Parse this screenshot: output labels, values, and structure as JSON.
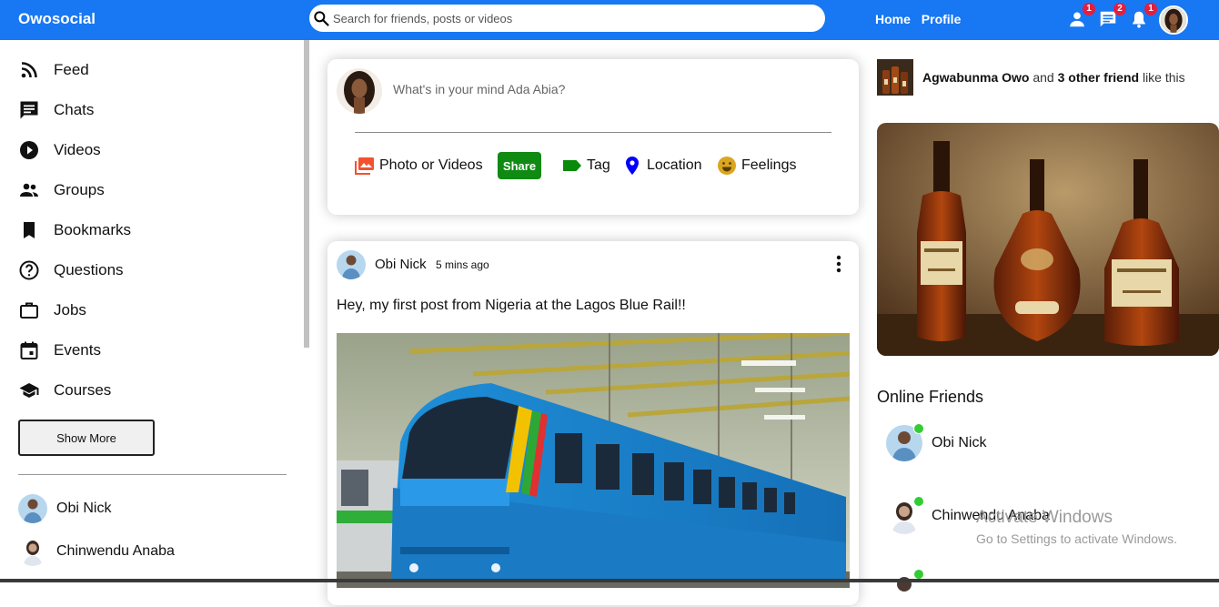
{
  "brand": {
    "name": "Owosocial",
    "color": "#1877f2"
  },
  "search": {
    "placeholder": "Search for friends, posts or videos"
  },
  "topbar": {
    "links": [
      "Home",
      "Profile"
    ],
    "badges": {
      "friends": "1",
      "chat": "2",
      "notifications": "1"
    }
  },
  "sidebar": {
    "items": [
      {
        "label": "Feed",
        "icon": "rss-feed-icon"
      },
      {
        "label": "Chats",
        "icon": "chat-icon"
      },
      {
        "label": "Videos",
        "icon": "play-circle-icon"
      },
      {
        "label": "Groups",
        "icon": "group-icon"
      },
      {
        "label": "Bookmarks",
        "icon": "bookmark-icon"
      },
      {
        "label": "Questions",
        "icon": "help-circle-icon"
      },
      {
        "label": "Jobs",
        "icon": "briefcase-icon"
      },
      {
        "label": "Events",
        "icon": "calendar-event-icon"
      },
      {
        "label": "Courses",
        "icon": "school-icon"
      }
    ],
    "show_more": "Show More",
    "friends": [
      "Obi Nick",
      "Chinwendu Anaba"
    ]
  },
  "share": {
    "placeholder": "What's in your mind Ada Abia?",
    "options": {
      "photo": "Photo or Videos",
      "tag": "Tag",
      "location": "Location",
      "feelings": "Feelings"
    },
    "share_button": "Share",
    "colors": {
      "photo": "#f3522f",
      "share": "#0f8a12",
      "tag": "#0a8a0a",
      "location": "#0000ff",
      "feelings": "#daa520"
    }
  },
  "post": {
    "user": "Obi Nick",
    "time": "5 mins ago",
    "text": "Hey, my first post from Nigeria at the Lagos Blue Rail!!"
  },
  "rightbar": {
    "birthday": {
      "name": "Agwabunma Owo",
      "middle": "and",
      "others": "3 other friend",
      "suffix": "like this"
    },
    "online_title": "Online Friends",
    "online_friends": [
      "Obi Nick",
      "Chinwendu Anaba"
    ]
  },
  "watermark": {
    "title": "Activate Windows",
    "subtitle": "Go to Settings to activate Windows."
  }
}
